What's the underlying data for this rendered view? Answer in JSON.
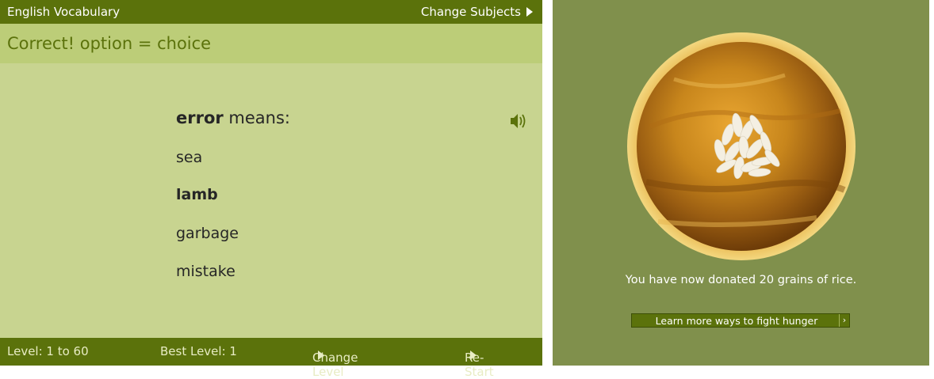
{
  "quiz": {
    "subject": "English Vocabulary",
    "change_subjects": "Change Subjects",
    "feedback": "Correct! option = choice",
    "question_word": "error",
    "question_suffix": " means:",
    "options": [
      "sea",
      "lamb",
      "garbage",
      "mistake"
    ],
    "footer": {
      "level": "Level: 1 to 60",
      "best_level": "Best Level: 1",
      "change_level": "Change Level",
      "restart": "Re-Start"
    }
  },
  "donation": {
    "message": "You have now donated 20 grains of rice.",
    "learn_button": "Learn more ways to fight hunger"
  },
  "icons": {
    "speaker": "speaker-icon",
    "arrow": "triangle-right-icon",
    "bowl": "rice-bowl-image"
  },
  "colors": {
    "dark_green": "#5b720b",
    "panel_light": "#c8d490",
    "feedback_bar": "#bccd78",
    "right_panel": "#80904c"
  }
}
